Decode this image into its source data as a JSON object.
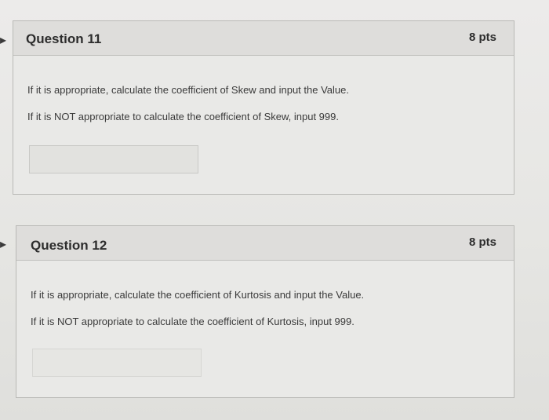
{
  "questions": [
    {
      "title": "Question 11",
      "points": "8 pts",
      "line1": "If it is appropriate, calculate the coefficient of Skew and input the Value.",
      "line2": "If it is NOT appropriate to calculate the coefficient of Skew, input 999.",
      "answer_value": ""
    },
    {
      "title": "Question 12",
      "points": "8 pts",
      "line1": "If it is appropriate, calculate the coefficient of Kurtosis and input the Value.",
      "line2": "If it is NOT appropriate to calculate the coefficient of Kurtosis, input 999.",
      "answer_value": ""
    }
  ]
}
